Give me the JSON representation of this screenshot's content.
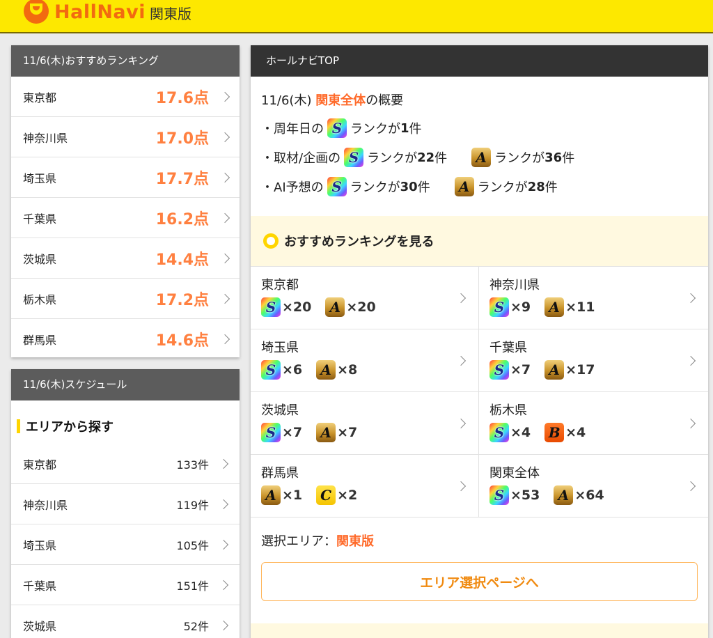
{
  "header": {
    "logo_text": "HallNavi",
    "logo_sub": "関東版"
  },
  "ranking": {
    "title": "11/6(木)おすすめランキング",
    "items": [
      {
        "name": "東京都",
        "score": "17.6点"
      },
      {
        "name": "神奈川県",
        "score": "17.0点"
      },
      {
        "name": "埼玉県",
        "score": "17.7点"
      },
      {
        "name": "千葉県",
        "score": "16.2点"
      },
      {
        "name": "茨城県",
        "score": "14.4点"
      },
      {
        "name": "栃木県",
        "score": "17.2点"
      },
      {
        "name": "群馬県",
        "score": "14.6点"
      }
    ]
  },
  "schedule": {
    "title": "11/6(木)スケジュール",
    "section_title": "エリアから探す",
    "items": [
      {
        "name": "東京都",
        "count": "133件"
      },
      {
        "name": "神奈川県",
        "count": "119件"
      },
      {
        "name": "埼玉県",
        "count": "105件"
      },
      {
        "name": "千葉県",
        "count": "151件"
      },
      {
        "name": "茨城県",
        "count": "52件"
      }
    ]
  },
  "main": {
    "title": "ホールナビTOP",
    "summary": {
      "date": "11/6(木) ",
      "region": "関東全体",
      "suffix": "の概要",
      "l1_pre": "・周年日の",
      "l1_mid": "ランクが",
      "l1_num": "1",
      "l1_unit": "件",
      "l2_pre": "・取材/企画の",
      "l2_mid": "ランクが",
      "l2_num_s": "22",
      "l2_unit": "件",
      "l2_num_a": "36",
      "l3_pre": "・AI予想の",
      "l3_mid": "ランクが",
      "l3_num_s": "30",
      "l3_unit": "件",
      "l3_num_a": "28"
    },
    "recommend_label": "おすすめランキングを見る",
    "areas": [
      {
        "name": "東京都",
        "b1": "S",
        "m1": "×20",
        "b2": "A",
        "m2": "×20"
      },
      {
        "name": "神奈川県",
        "b1": "S",
        "m1": "×9",
        "b2": "A",
        "m2": "×11"
      },
      {
        "name": "埼玉県",
        "b1": "S",
        "m1": "×6",
        "b2": "A",
        "m2": "×8"
      },
      {
        "name": "千葉県",
        "b1": "S",
        "m1": "×7",
        "b2": "A",
        "m2": "×17"
      },
      {
        "name": "茨城県",
        "b1": "S",
        "m1": "×7",
        "b2": "A",
        "m2": "×7"
      },
      {
        "name": "栃木県",
        "b1": "S",
        "m1": "×4",
        "b2": "B",
        "m2": "×4"
      },
      {
        "name": "群馬県",
        "b1": "A",
        "m1": "×1",
        "b2": "C",
        "m2": "×2"
      },
      {
        "name": "関東全体",
        "b1": "S",
        "m1": "×53",
        "b2": "A",
        "m2": "×64"
      }
    ],
    "area_label": "選択エリア：",
    "area_value": "関東版",
    "area_button": "エリア選択ページへ"
  },
  "badges": {
    "S": "S",
    "A": "A",
    "B": "B",
    "C": "C"
  }
}
